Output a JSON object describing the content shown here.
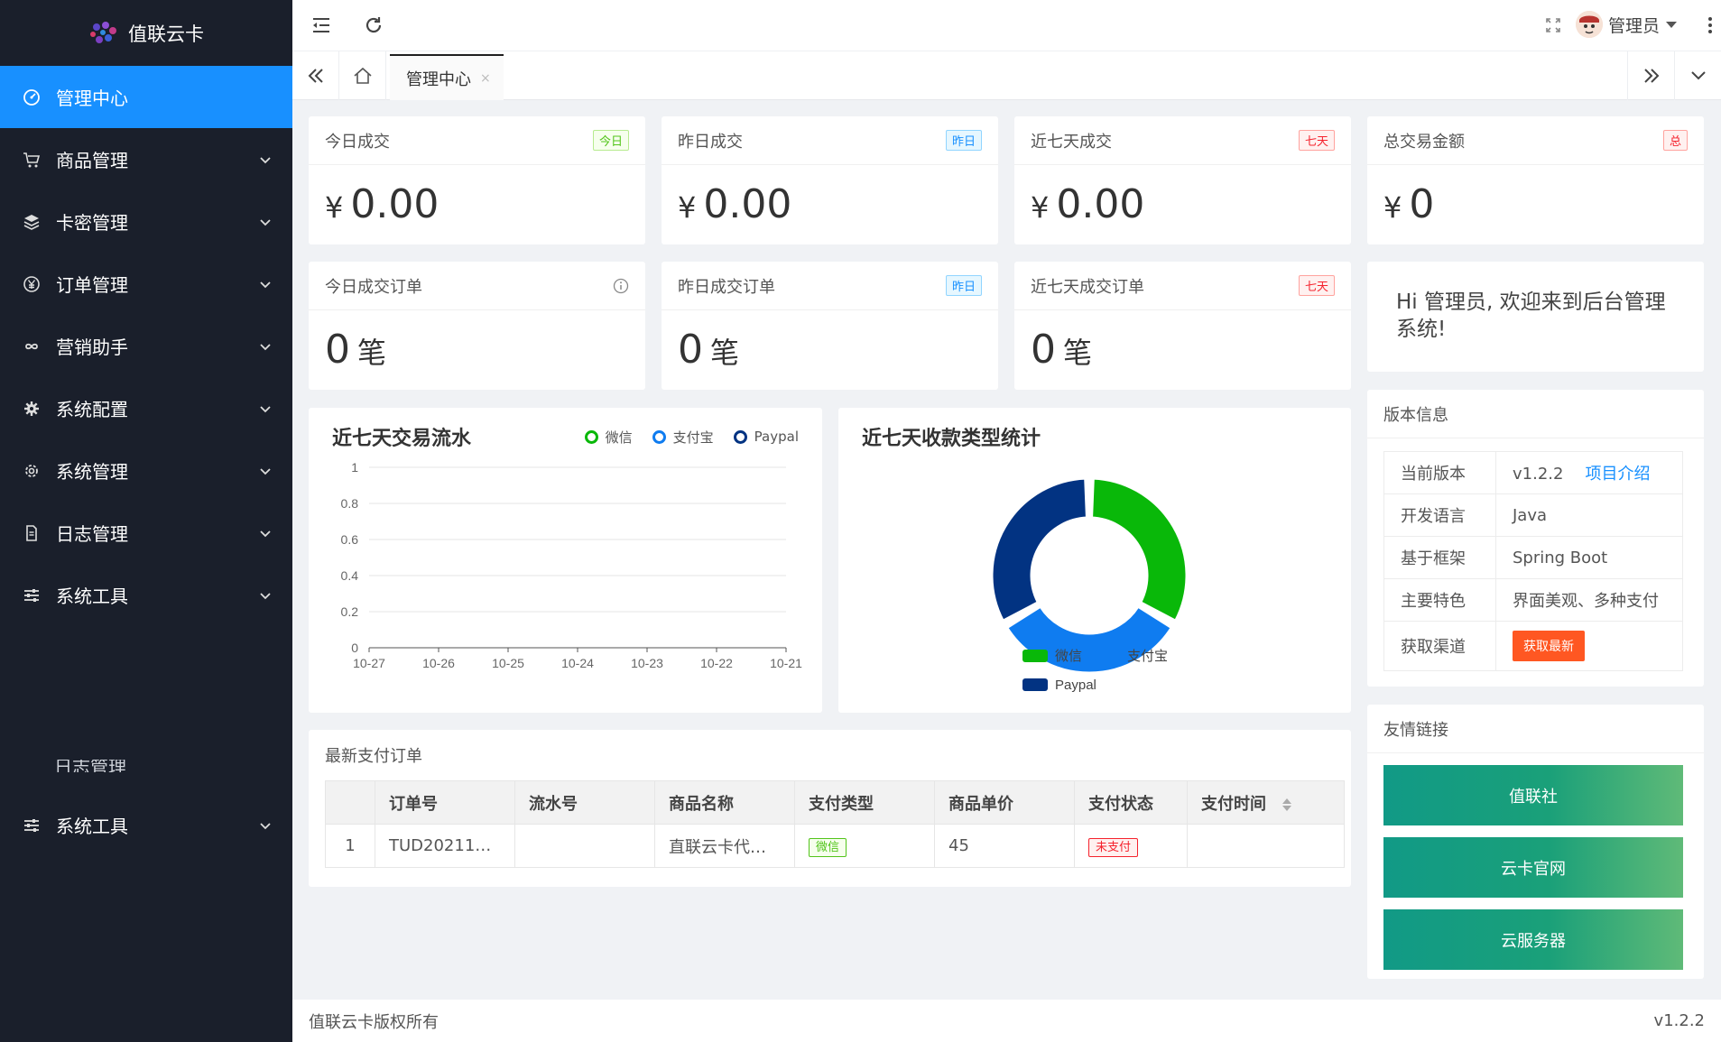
{
  "sidebar": {
    "app_name": "值联云卡",
    "items": [
      {
        "label": "管理中心",
        "icon": "dashboard-icon"
      },
      {
        "label": "商品管理",
        "icon": "cart-icon"
      },
      {
        "label": "卡密管理",
        "icon": "layers-icon"
      },
      {
        "label": "订单管理",
        "icon": "yen-icon"
      },
      {
        "label": "营销助手",
        "icon": "infinity-icon"
      },
      {
        "label": "系统配置",
        "icon": "gear-icon"
      },
      {
        "label": "系统管理",
        "icon": "settings-icon"
      },
      {
        "label": "日志管理",
        "icon": "document-icon"
      },
      {
        "label": "系统工具",
        "icon": "sliders-icon"
      }
    ],
    "ghost_label": "日志管理",
    "extra_item": {
      "label": "系统工具",
      "icon": "sliders-icon"
    }
  },
  "header": {
    "user_name": "管理员"
  },
  "tabs": {
    "active_label": "管理中心",
    "close_glyph": "×"
  },
  "stats": [
    {
      "title": "今日成交",
      "badge": "今日",
      "currency": "¥",
      "value": "0.00"
    },
    {
      "title": "昨日成交",
      "badge": "昨日",
      "currency": "¥",
      "value": "0.00"
    },
    {
      "title": "近七天成交",
      "badge": "七天",
      "currency": "¥",
      "value": "0.00"
    },
    {
      "title": "总交易金额",
      "badge": "总",
      "currency": "¥",
      "value": "0"
    }
  ],
  "order_stats": [
    {
      "title": "今日成交订单",
      "value": "0",
      "unit": "笔"
    },
    {
      "title": "昨日成交订单",
      "badge": "昨日",
      "value": "0",
      "unit": "笔"
    },
    {
      "title": "近七天成交订单",
      "badge": "七天",
      "value": "0",
      "unit": "笔"
    }
  ],
  "welcome": "Hi 管理员, 欢迎来到后台管理系统!",
  "colors": {
    "wechat": "#09b809",
    "alipay": "#0f7cf0",
    "paypal": "#023382",
    "active_menu": "#1890ff"
  },
  "chart_data": [
    {
      "type": "line",
      "title": "近七天交易流水",
      "categories": [
        "10-27",
        "10-26",
        "10-25",
        "10-24",
        "10-23",
        "10-22",
        "10-21"
      ],
      "series": [
        {
          "name": "微信",
          "values": [
            0,
            0,
            0,
            0,
            0,
            0,
            0
          ]
        },
        {
          "name": "支付宝",
          "values": [
            0,
            0,
            0,
            0,
            0,
            0,
            0
          ]
        },
        {
          "name": "Paypal",
          "values": [
            0,
            0,
            0,
            0,
            0,
            0,
            0
          ]
        }
      ],
      "yticks": [
        "1",
        "0.8",
        "0.6",
        "0.4",
        "0.2",
        "0"
      ],
      "ylim": [
        0,
        1
      ],
      "grid": true,
      "legend": "top-right"
    },
    {
      "type": "pie",
      "title": "近七天收款类型统计",
      "labels": [
        "微信",
        "支付宝",
        "Paypal"
      ],
      "values": [
        1,
        1,
        1
      ],
      "legend": "bottom"
    }
  ],
  "version": {
    "title": "版本信息",
    "rows": [
      {
        "k": "当前版本",
        "v": "v1.2.2",
        "link": "项目介绍"
      },
      {
        "k": "开发语言",
        "v": "Java"
      },
      {
        "k": "基于框架",
        "v": "Spring Boot"
      },
      {
        "k": "主要特色",
        "v": "界面美观、多种支付"
      },
      {
        "k": "获取渠道",
        "button": "获取最新"
      }
    ]
  },
  "friends": {
    "title": "友情链接",
    "links": [
      "值联社",
      "云卡官网",
      "云服务器"
    ]
  },
  "orders": {
    "title": "最新支付订单",
    "columns": [
      "订单号",
      "流水号",
      "商品名称",
      "支付类型",
      "商品单价",
      "支付状态",
      "支付时间"
    ],
    "rows": [
      {
        "index": "1",
        "order_no": "TUD20211…",
        "serial": "",
        "product": "直联云卡代…",
        "pay_type": "微信",
        "price": "45",
        "status": "未支付",
        "time": ""
      }
    ]
  },
  "footer": {
    "copyright": "值联云卡版权所有",
    "version": "v1.2.2"
  }
}
